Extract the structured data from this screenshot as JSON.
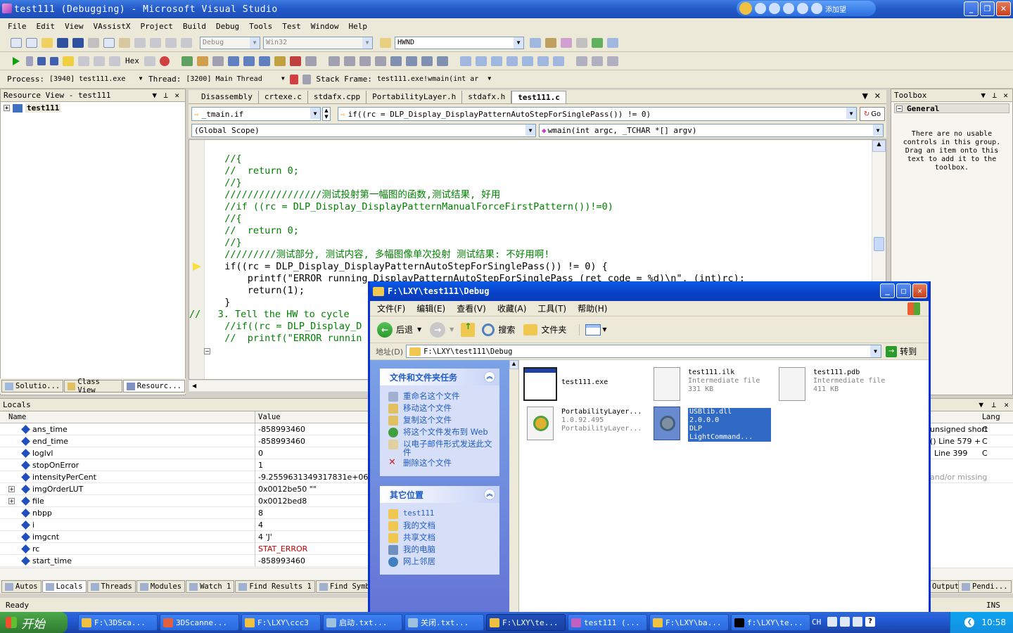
{
  "vs": {
    "title": "test111 (Debugging) - Microsoft Visual Studio",
    "media_label": "添加望",
    "menu": [
      "File",
      "Edit",
      "View",
      "VAssistX",
      "Project",
      "Build",
      "Debug",
      "Tools",
      "Test",
      "Window",
      "Help"
    ],
    "config_combo": "Debug",
    "platform_combo": "Win32",
    "find_combo": "HWND",
    "hex_label": "Hex",
    "process_label": "Process:",
    "process_value": "[3940] test111.exe",
    "thread_label": "Thread:",
    "thread_value": "[3200] Main Thread",
    "stackframe_label": "Stack Frame:",
    "stackframe_value": "test111.exe!wmain(int ar",
    "resource_view_title": "Resource View - test111",
    "resource_tree_item": "test111",
    "left_tabs": [
      "Solutio...",
      "Class View",
      "Resourc..."
    ],
    "doc_tabs": [
      "Disassembly",
      "crtexe.c",
      "stdafx.cpp",
      "PortabilityLayer.h",
      "stdafx.h",
      "test111.c"
    ],
    "nav_left": "_tmain.if",
    "nav_right": "if((rc = DLP_Display_DisplayPatternAutoStepForSinglePass()) != 0)",
    "go_label": "Go",
    "scope_left": "(Global Scope)",
    "scope_right": "wmain(int argc, _TCHAR *[] argv)",
    "code_lines": [
      "  //{",
      "  //  return 0;",
      "  //}",
      "  /////////////////测试投射第一幅图的函数,测试结果, 好用",
      "  //if ((rc = DLP_Display_DisplayPatternManualForceFirstPattern())!=0)",
      "  //{",
      "  //  return 0;",
      "  //}",
      "  /////////测试部分, 测试内容, 多幅图像单次投射 测试结果: 不好用啊!",
      "  if((rc = DLP_Display_DisplayPatternAutoStepForSinglePass()) != 0) {",
      "      printf(\"ERROR running DisplayPatternAutoStepForSinglePass (ret code = %d)\\n\", (int)rc);",
      "      return(1);",
      "  }",
      "",
      "",
      "",
      "//   3. Tell the HW to cycle",
      "  //if((rc = DLP_Display_D",
      "  //  printf(\"ERROR runnin"
    ],
    "toolbox_title": "Toolbox",
    "toolbox_group": "General",
    "toolbox_empty": "There are no usable controls in this group. Drag an item onto this text to add it to the toolbox.",
    "locals_title": "Locals",
    "locals_headers": [
      "Name",
      "Value"
    ],
    "locals": [
      {
        "name": "ans_time",
        "value": "-858993460",
        "expand": false
      },
      {
        "name": "end_time",
        "value": "-858993460",
        "expand": false
      },
      {
        "name": "loglvl",
        "value": "0",
        "expand": false
      },
      {
        "name": "stopOnError",
        "value": "1",
        "expand": false
      },
      {
        "name": "intensityPerCent",
        "value": "-9.2559631349317831e+061",
        "expand": false
      },
      {
        "name": "imgOrderLUT",
        "value": "0x0012be50 \"\"",
        "expand": true
      },
      {
        "name": "file",
        "value": "0x0012bed8",
        "expand": true
      },
      {
        "name": "nbpp",
        "value": "8",
        "expand": false
      },
      {
        "name": "i",
        "value": "4",
        "expand": false
      },
      {
        "name": "imgcnt",
        "value": "4 'J'",
        "expand": false
      },
      {
        "name": "rc",
        "value": "STAT_ERROR",
        "expand": false,
        "changed": true
      },
      {
        "name": "start_time",
        "value": "-858993460",
        "expand": false
      }
    ],
    "right_panel_header": "Lang",
    "right_panel_rows": [
      {
        "text": "unsigned short",
        "lang": "C"
      },
      {
        "text": "() Line 579 +",
        "lang": "C"
      },
      {
        "text": "Line 399",
        "lang": "C"
      },
      {
        "text": "and/or missing",
        "lang": ""
      }
    ],
    "bottom_tabs": [
      "Autos",
      "Locals",
      "Threads",
      "Modules",
      "Watch 1",
      "Find Results 1",
      "Find Symbol Re"
    ],
    "bottom_tabs_right": [
      "Output",
      "Pendi..."
    ],
    "status_left": "Ready",
    "status_right": "INS"
  },
  "explorer": {
    "title": "F:\\LXY\\test111\\Debug",
    "menu": [
      "文件(F)",
      "编辑(E)",
      "查看(V)",
      "收藏(A)",
      "工具(T)",
      "帮助(H)"
    ],
    "back_label": "后退",
    "search_label": "搜索",
    "folders_label": "文件夹",
    "address_label": "地址(D)",
    "address_value": "F:\\LXY\\test111\\Debug",
    "go_label": "转到",
    "tasks_title": "文件和文件夹任务",
    "tasks": [
      "重命名这个文件",
      "移动这个文件",
      "复制这个文件",
      "将这个文件发布到 Web",
      "以电子邮件形式发送此文件",
      "删除这个文件"
    ],
    "places_title": "其它位置",
    "places": [
      "test111",
      "我的文档",
      "共享文档",
      "我的电脑",
      "网上邻居"
    ],
    "files": [
      {
        "name": "test111.exe",
        "line2": "",
        "line3": ""
      },
      {
        "name": "test111.ilk",
        "line2": "Intermediate file",
        "line3": "331 KB"
      },
      {
        "name": "test111.pdb",
        "line2": "Intermediate file",
        "line3": "411 KB"
      },
      {
        "name": "PortabilityLayer...",
        "line2": "1.0.92.495",
        "line3": "PortabilityLayer..."
      },
      {
        "name": "USBlib.dll",
        "line2": "2.0.0.0",
        "line3": "DLP LightCommand..."
      }
    ]
  },
  "taskbar": {
    "start": "开始",
    "tasks": [
      "F:\\3DSca...",
      "3DScanne...",
      "F:\\LXY\\ccc3",
      "启动.txt...",
      "关闭.txt...",
      "F:\\LXY\\te...",
      "test111 (...",
      "F:\\LXY\\ba...",
      "f:\\LXY\\te..."
    ],
    "lang": "CH",
    "clock": "10:58"
  },
  "colors": {
    "xp_blue": "#0a5ae8",
    "comment": "#008000",
    "keyword": "#0000ff",
    "error": "#c00000"
  }
}
